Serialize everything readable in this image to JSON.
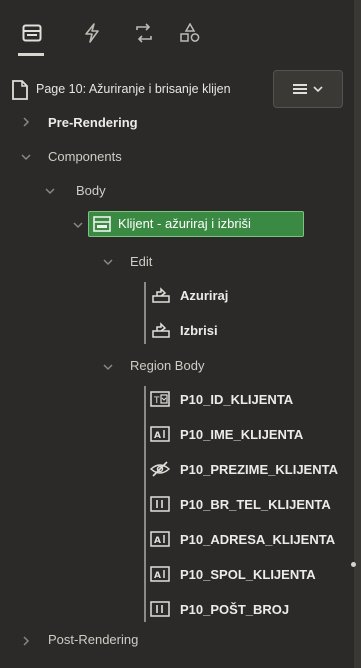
{
  "toolbar": {
    "tabs": [
      {
        "icon": "rendering-tree-icon",
        "active": true
      },
      {
        "icon": "dynamic-actions-icon",
        "active": false
      },
      {
        "icon": "processing-icon",
        "active": false
      },
      {
        "icon": "shared-components-icon",
        "active": false
      }
    ]
  },
  "page": {
    "title": "Page 10: Ažuriranje i brisanje klijen",
    "menu_icon": "hamburger-menu-icon"
  },
  "tree": {
    "pre_rendering": "Pre-Rendering",
    "components": "Components",
    "body": "Body",
    "region": "Klijent - ažuriraj i izbriši",
    "edit": "Edit",
    "buttons": [
      "Azuriraj",
      "Izbrisi"
    ],
    "region_body": "Region Body",
    "items": [
      {
        "label": "P10_ID_KLIJENTA",
        "icon": "select-list-icon"
      },
      {
        "label": "P10_IME_KLIJENTA",
        "icon": "text-field-icon"
      },
      {
        "label": "P10_PREZIME_KLIJENTA",
        "icon": "hidden-item-icon"
      },
      {
        "label": "P10_BR_TEL_KLIJENTA",
        "icon": "number-field-icon"
      },
      {
        "label": "P10_ADRESA_KLIJENTA",
        "icon": "text-field-icon"
      },
      {
        "label": "P10_SPOL_KLIJENTA",
        "icon": "text-field-icon"
      },
      {
        "label": "P10_POŠT_BROJ",
        "icon": "number-field-icon"
      }
    ],
    "post_rendering": "Post-Rendering"
  },
  "colors": {
    "background": "#2b2a28",
    "region_highlight": "#3a8a43",
    "text": "#e6e4e0"
  }
}
